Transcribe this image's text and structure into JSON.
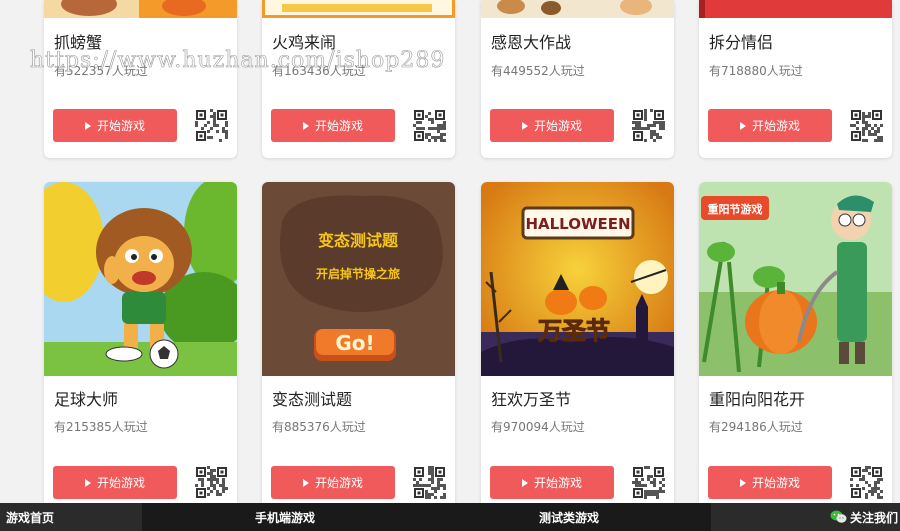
{
  "watermark": "https://www.huzhan.com/ishop289",
  "play_button_label": "开始游戏",
  "games": [
    {
      "title": "抓螃蟹",
      "plays": "有522357人玩过"
    },
    {
      "title": "火鸡来闹",
      "plays": "有163436人玩过"
    },
    {
      "title": "感恩大作战",
      "plays": "有449552人玩过"
    },
    {
      "title": "拆分情侣",
      "plays": "有718880人玩过"
    },
    {
      "title": "足球大师",
      "plays": "有215385人玩过"
    },
    {
      "title": "变态测试题",
      "plays": "有885376人玩过",
      "art_title": "变态测试题",
      "art_subtitle": "开启掉节操之旅",
      "art_button": "Go!"
    },
    {
      "title": "狂欢万圣节",
      "plays": "有970094人玩过",
      "art_title": "HALLOWEEN",
      "art_subtitle": "万圣节"
    },
    {
      "title": "重阳向阳花开",
      "plays": "有294186人玩过",
      "art_badge": "重阳节游戏"
    }
  ],
  "bottom_nav": {
    "home": "游戏首页",
    "mobile": "手机端游戏",
    "test": "测试类游戏",
    "follow": "关注我们"
  },
  "colors": {
    "play_button": "#f05a5a",
    "bottom_bar": "#1a1a1a"
  }
}
